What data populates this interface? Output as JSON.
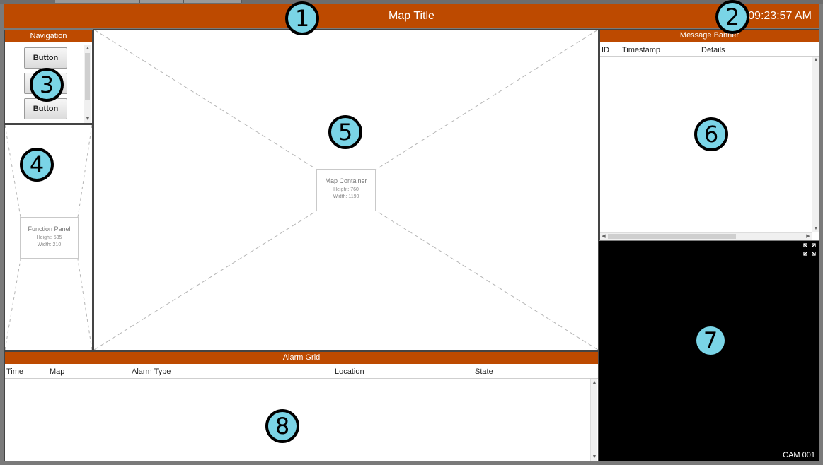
{
  "header": {
    "title": "Map Title",
    "clock": "09:23:57 AM"
  },
  "navigation": {
    "header": "Navigation",
    "buttons": [
      "Button",
      "Button",
      "Button"
    ]
  },
  "function_panel": {
    "title": "Function Panel",
    "height_label": "Height: 535",
    "width_label": "Width: 210"
  },
  "map": {
    "title": "Map Container",
    "height_label": "Height: 760",
    "width_label": "Width: 1190"
  },
  "message_banner": {
    "header": "Message Banner",
    "columns": [
      "ID",
      "Timestamp",
      "Details"
    ]
  },
  "camera": {
    "label": "CAM 001"
  },
  "alarm_grid": {
    "header": "Alarm Grid",
    "columns": [
      "Time",
      "Map",
      "Alarm Type",
      "Location",
      "State"
    ]
  },
  "markers": [
    "1",
    "2",
    "3",
    "4",
    "5",
    "6",
    "7",
    "8"
  ],
  "colors": {
    "accent": "#bd4a00",
    "marker": "#7ad4e6"
  }
}
